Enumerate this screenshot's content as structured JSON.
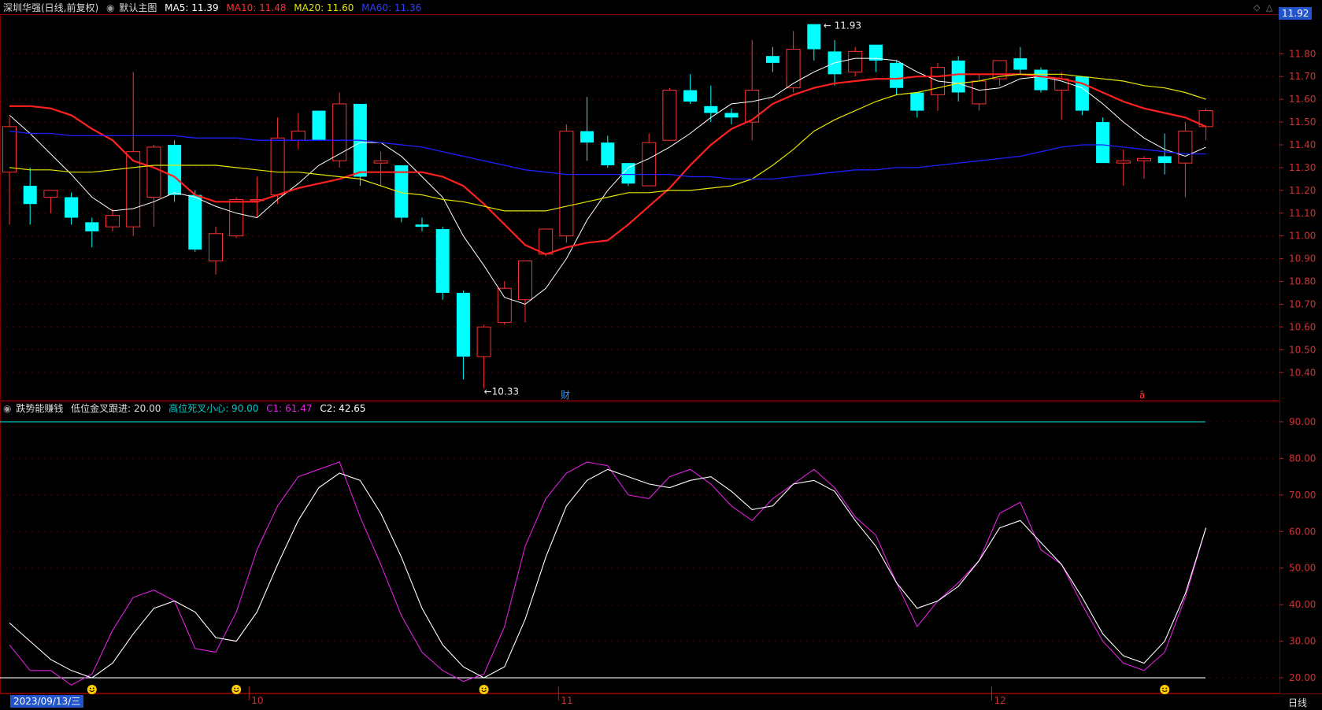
{
  "main_header": {
    "stock": "深圳华强(日线,前复权)",
    "indicator_menu": "默认主图",
    "ma5": "MA5: 11.39",
    "ma10": "MA10: 11.48",
    "ma20": "MA20: 11.60",
    "ma60": "MA60: 11.36"
  },
  "sub_header": {
    "indicator_name": "跌势能赚钱",
    "low_label": "低位金叉跟进: 20.00",
    "high_label": "高位死叉小心: 90.00",
    "c1": "C1: 61.47",
    "c2": "C2: 42.65"
  },
  "current_price_tag": "11.92",
  "bottom_bar": {
    "date_pill": "2023/09/13/三",
    "period_label": "日线",
    "months": [
      "10",
      "11",
      "12"
    ]
  },
  "annotations": {
    "high": "11.93",
    "low": "10.33",
    "finance_marker": "财",
    "red_marker": "ä"
  },
  "colors": {
    "up": "#ff3333",
    "down": "#00ffff",
    "ma5": "#ffffff",
    "ma10": "#ff2020",
    "ma20": "#e6e600",
    "ma60": "#2020ff",
    "c1": "#e020e0",
    "c2": "#ffffff",
    "grid": "#5a0000",
    "axis_text": "#cc3333",
    "cyan_line": "#00cccc",
    "smiley": "#ffcc00"
  },
  "chart_data": [
    {
      "type": "candlestick",
      "title": "深圳华强(日线,前复权)",
      "y_ticks": [
        "11.80",
        "11.70",
        "11.60",
        "11.50",
        "11.40",
        "11.30",
        "11.20",
        "11.10",
        "11.00",
        "10.90",
        "10.80",
        "10.70",
        "10.60",
        "10.50",
        "10.40"
      ],
      "ylim": [
        10.28,
        11.96
      ],
      "candles": [
        {
          "o": 11.28,
          "h": 11.52,
          "l": 11.05,
          "c": 11.48
        },
        {
          "o": 11.22,
          "h": 11.3,
          "l": 11.05,
          "c": 11.14
        },
        {
          "o": 11.17,
          "h": 11.2,
          "l": 11.1,
          "c": 11.2
        },
        {
          "o": 11.17,
          "h": 11.19,
          "l": 11.05,
          "c": 11.08
        },
        {
          "o": 11.06,
          "h": 11.08,
          "l": 10.95,
          "c": 11.02
        },
        {
          "o": 11.04,
          "h": 11.12,
          "l": 11.02,
          "c": 11.09
        },
        {
          "o": 11.04,
          "h": 11.72,
          "l": 11.0,
          "c": 11.37
        },
        {
          "o": 11.17,
          "h": 11.4,
          "l": 11.04,
          "c": 11.39
        },
        {
          "o": 11.4,
          "h": 11.42,
          "l": 11.15,
          "c": 11.18
        },
        {
          "o": 11.18,
          "h": 11.2,
          "l": 10.93,
          "c": 10.94
        },
        {
          "o": 10.89,
          "h": 11.04,
          "l": 10.83,
          "c": 11.01
        },
        {
          "o": 11.0,
          "h": 11.17,
          "l": 10.99,
          "c": 11.16
        },
        {
          "o": 11.16,
          "h": 11.26,
          "l": 11.08,
          "c": 11.16
        },
        {
          "o": 11.18,
          "h": 11.52,
          "l": 11.14,
          "c": 11.43
        },
        {
          "o": 11.42,
          "h": 11.54,
          "l": 11.38,
          "c": 11.46
        },
        {
          "o": 11.55,
          "h": 11.55,
          "l": 11.42,
          "c": 11.42
        },
        {
          "o": 11.33,
          "h": 11.63,
          "l": 11.3,
          "c": 11.58
        },
        {
          "o": 11.58,
          "h": 11.58,
          "l": 11.22,
          "c": 11.26
        },
        {
          "o": 11.32,
          "h": 11.37,
          "l": 11.22,
          "c": 11.33
        },
        {
          "o": 11.31,
          "h": 11.31,
          "l": 11.06,
          "c": 11.08
        },
        {
          "o": 11.05,
          "h": 11.08,
          "l": 11.02,
          "c": 11.04
        },
        {
          "o": 11.03,
          "h": 11.04,
          "l": 10.72,
          "c": 10.75
        },
        {
          "o": 10.75,
          "h": 10.76,
          "l": 10.37,
          "c": 10.47
        },
        {
          "o": 10.47,
          "h": 10.61,
          "l": 10.33,
          "c": 10.6
        },
        {
          "o": 10.62,
          "h": 10.8,
          "l": 10.61,
          "c": 10.77
        },
        {
          "o": 10.72,
          "h": 10.89,
          "l": 10.62,
          "c": 10.89
        },
        {
          "o": 10.92,
          "h": 11.03,
          "l": 10.91,
          "c": 11.03
        },
        {
          "o": 11.0,
          "h": 11.49,
          "l": 10.97,
          "c": 11.46
        },
        {
          "o": 11.46,
          "h": 11.61,
          "l": 11.33,
          "c": 11.41
        },
        {
          "o": 11.41,
          "h": 11.44,
          "l": 11.3,
          "c": 11.31
        },
        {
          "o": 11.32,
          "h": 11.32,
          "l": 11.22,
          "c": 11.23
        },
        {
          "o": 11.22,
          "h": 11.45,
          "l": 11.22,
          "c": 11.41
        },
        {
          "o": 11.42,
          "h": 11.65,
          "l": 11.42,
          "c": 11.64
        },
        {
          "o": 11.64,
          "h": 11.71,
          "l": 11.58,
          "c": 11.59
        },
        {
          "o": 11.57,
          "h": 11.66,
          "l": 11.5,
          "c": 11.54
        },
        {
          "o": 11.54,
          "h": 11.56,
          "l": 11.49,
          "c": 11.52
        },
        {
          "o": 11.5,
          "h": 11.86,
          "l": 11.42,
          "c": 11.64
        },
        {
          "o": 11.79,
          "h": 11.83,
          "l": 11.72,
          "c": 11.76
        },
        {
          "o": 11.65,
          "h": 11.9,
          "l": 11.63,
          "c": 11.82
        },
        {
          "o": 11.93,
          "h": 11.93,
          "l": 11.77,
          "c": 11.82
        },
        {
          "o": 11.81,
          "h": 11.86,
          "l": 11.66,
          "c": 11.71
        },
        {
          "o": 11.72,
          "h": 11.83,
          "l": 11.7,
          "c": 11.81
        },
        {
          "o": 11.84,
          "h": 11.84,
          "l": 11.72,
          "c": 11.77
        },
        {
          "o": 11.76,
          "h": 11.77,
          "l": 11.62,
          "c": 11.65
        },
        {
          "o": 11.63,
          "h": 11.63,
          "l": 11.52,
          "c": 11.55
        },
        {
          "o": 11.62,
          "h": 11.76,
          "l": 11.55,
          "c": 11.74
        },
        {
          "o": 11.77,
          "h": 11.79,
          "l": 11.59,
          "c": 11.63
        },
        {
          "o": 11.58,
          "h": 11.71,
          "l": 11.55,
          "c": 11.68
        },
        {
          "o": 11.69,
          "h": 11.77,
          "l": 11.66,
          "c": 11.77
        },
        {
          "o": 11.78,
          "h": 11.83,
          "l": 11.71,
          "c": 11.73
        },
        {
          "o": 11.73,
          "h": 11.74,
          "l": 11.63,
          "c": 11.64
        },
        {
          "o": 11.64,
          "h": 11.72,
          "l": 11.51,
          "c": 11.69
        },
        {
          "o": 11.7,
          "h": 11.7,
          "l": 11.53,
          "c": 11.55
        },
        {
          "o": 11.5,
          "h": 11.52,
          "l": 11.32,
          "c": 11.32
        },
        {
          "o": 11.32,
          "h": 11.38,
          "l": 11.22,
          "c": 11.33
        },
        {
          "o": 11.33,
          "h": 11.35,
          "l": 11.25,
          "c": 11.34
        },
        {
          "o": 11.35,
          "h": 11.45,
          "l": 11.27,
          "c": 11.32
        },
        {
          "o": 11.32,
          "h": 11.5,
          "l": 11.17,
          "c": 11.46
        },
        {
          "o": 11.48,
          "h": 11.56,
          "l": 11.42,
          "c": 11.55
        }
      ],
      "series": [
        {
          "name": "MA5",
          "values": [
            11.53,
            11.45,
            11.36,
            11.27,
            11.17,
            11.11,
            11.12,
            11.15,
            11.19,
            11.17,
            11.13,
            11.1,
            11.08,
            11.16,
            11.23,
            11.31,
            11.36,
            11.41,
            11.41,
            11.35,
            11.26,
            11.17,
            11.0,
            10.87,
            10.73,
            10.7,
            10.77,
            10.9,
            11.07,
            11.2,
            11.3,
            11.34,
            11.39,
            11.45,
            11.52,
            11.58,
            11.59,
            11.61,
            11.67,
            11.72,
            11.76,
            11.78,
            11.78,
            11.77,
            11.72,
            11.68,
            11.67,
            11.64,
            11.65,
            11.69,
            11.7,
            11.68,
            11.65,
            11.58,
            11.5,
            11.43,
            11.38,
            11.35,
            11.39
          ]
        },
        {
          "name": "MA10",
          "values": [
            11.57,
            11.57,
            11.56,
            11.53,
            11.47,
            11.42,
            11.33,
            11.3,
            11.26,
            11.18,
            11.15,
            11.15,
            11.15,
            11.18,
            11.21,
            11.23,
            11.25,
            11.28,
            11.28,
            11.28,
            11.28,
            11.26,
            11.22,
            11.14,
            11.05,
            10.96,
            10.92,
            10.95,
            10.97,
            10.98,
            11.05,
            11.13,
            11.21,
            11.31,
            11.4,
            11.47,
            11.51,
            11.58,
            11.62,
            11.65,
            11.67,
            11.68,
            11.69,
            11.69,
            11.7,
            11.7,
            11.71,
            11.71,
            11.71,
            11.71,
            11.7,
            11.69,
            11.67,
            11.63,
            11.59,
            11.56,
            11.54,
            11.52,
            11.48
          ]
        },
        {
          "name": "MA20",
          "values": [
            11.3,
            11.29,
            11.29,
            11.28,
            11.28,
            11.29,
            11.3,
            11.31,
            11.31,
            11.31,
            11.31,
            11.3,
            11.29,
            11.28,
            11.28,
            11.27,
            11.26,
            11.25,
            11.22,
            11.19,
            11.18,
            11.16,
            11.15,
            11.13,
            11.11,
            11.11,
            11.11,
            11.13,
            11.15,
            11.17,
            11.19,
            11.19,
            11.2,
            11.2,
            11.21,
            11.22,
            11.25,
            11.31,
            11.38,
            11.46,
            11.51,
            11.55,
            11.59,
            11.62,
            11.63,
            11.65,
            11.67,
            11.68,
            11.7,
            11.71,
            11.71,
            11.71,
            11.7,
            11.69,
            11.68,
            11.66,
            11.65,
            11.63,
            11.6
          ]
        },
        {
          "name": "MA60",
          "values": [
            11.46,
            11.45,
            11.45,
            11.44,
            11.44,
            11.44,
            11.44,
            11.44,
            11.44,
            11.43,
            11.43,
            11.43,
            11.42,
            11.42,
            11.42,
            11.42,
            11.42,
            11.42,
            11.41,
            11.4,
            11.39,
            11.37,
            11.35,
            11.33,
            11.31,
            11.29,
            11.28,
            11.27,
            11.27,
            11.27,
            11.27,
            11.27,
            11.27,
            11.26,
            11.26,
            11.25,
            11.25,
            11.25,
            11.26,
            11.27,
            11.28,
            11.29,
            11.29,
            11.3,
            11.3,
            11.31,
            11.32,
            11.33,
            11.34,
            11.35,
            11.37,
            11.39,
            11.4,
            11.4,
            11.39,
            11.38,
            11.37,
            11.36,
            11.36
          ]
        }
      ]
    },
    {
      "type": "line",
      "title": "跌势能赚钱",
      "y_ticks": [
        "90.00",
        "80.00",
        "70.00",
        "60.00",
        "50.00",
        "40.00",
        "30.00",
        "20.00"
      ],
      "ylim": [
        17,
        93
      ],
      "reference_lines": [
        {
          "name": "高位死叉小心",
          "value": 90
        },
        {
          "name": "低位金叉跟进",
          "value": 20
        }
      ],
      "series": [
        {
          "name": "C1",
          "values": [
            29,
            22,
            22,
            18,
            21,
            33,
            42,
            44,
            41,
            28,
            27,
            38,
            55,
            67,
            75,
            77,
            79,
            64,
            51,
            37,
            27,
            22,
            19,
            21,
            34,
            56,
            69,
            76,
            79,
            78,
            70,
            69,
            75,
            77,
            73,
            67,
            63,
            69,
            73,
            77,
            72,
            64,
            59,
            46,
            34,
            41,
            46,
            52,
            65,
            68,
            55,
            51,
            40,
            30,
            24,
            22,
            27,
            42,
            61
          ]
        },
        {
          "name": "C2",
          "values": [
            35,
            30,
            25,
            22,
            20,
            24,
            32,
            39,
            41,
            38,
            31,
            30,
            38,
            51,
            63,
            72,
            76,
            74,
            65,
            53,
            39,
            29,
            23,
            20,
            23,
            36,
            53,
            67,
            74,
            77,
            75,
            73,
            72,
            74,
            75,
            71,
            66,
            67,
            73,
            74,
            71,
            63,
            56,
            46,
            39,
            41,
            45,
            52,
            61,
            63,
            57,
            51,
            42,
            32,
            26,
            24,
            30,
            43,
            61
          ]
        }
      ]
    }
  ]
}
